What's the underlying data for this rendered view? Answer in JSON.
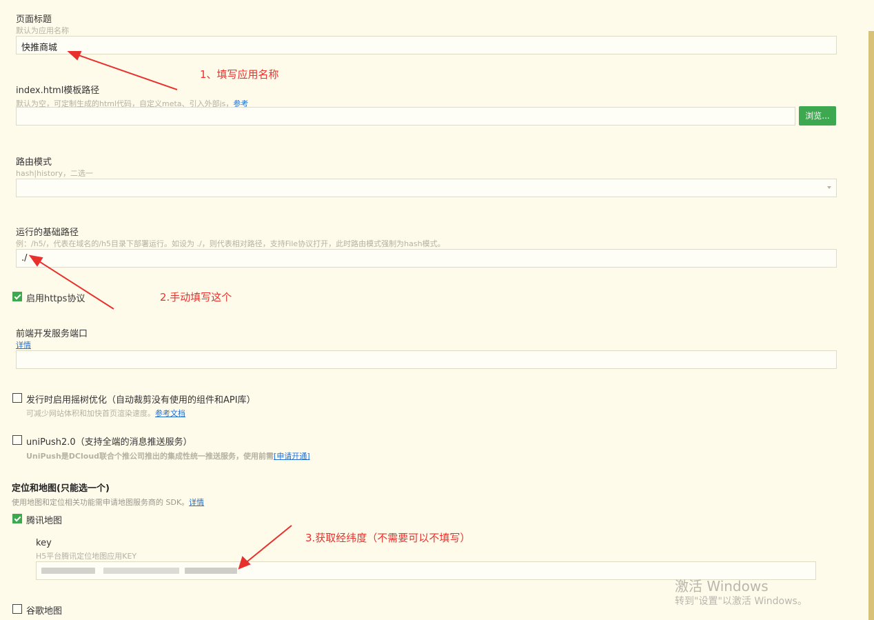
{
  "page_title": {
    "label": "页面标题",
    "hint": "默认为应用名称",
    "value": "快推商城"
  },
  "template_path": {
    "label": "index.html模板路径",
    "hint": "默认为空，可定制生成的html代码，自定义meta、引入外部js，",
    "hint_link": "参考",
    "value": "",
    "browse_label": "浏览..."
  },
  "router_mode": {
    "label": "路由模式",
    "hint": "hash|history，二选一",
    "value": ""
  },
  "base_path": {
    "label": "运行的基础路径",
    "hint": "例：/h5/，代表在域名的/h5目录下部署运行。如设为 ./，则代表相对路径，支持File协议打开，此时路由模式强制为hash模式。",
    "value": "./"
  },
  "https": {
    "label": "启用https协议",
    "checked": true
  },
  "dev_port": {
    "label": "前端开发服务端口",
    "link": "详情",
    "value": ""
  },
  "tree_shaking": {
    "label": "发行时启用摇树优化（自动裁剪没有使用的组件和API库）",
    "hint": "可减少网站体积和加快首页渲染速度。",
    "hint_link": "参考文档",
    "checked": false
  },
  "unipush": {
    "label": "uniPush2.0（支持全端的消息推送服务）",
    "hint": "UniPush是DCloud联合个推公司推出的集成性统一推送服务，使用前需",
    "hint_link": "[申请开通]",
    "checked": false
  },
  "location": {
    "title": "定位和地图(只能选一个)",
    "hint": "使用地图和定位相关功能需申请地图服务商的 SDK。",
    "hint_link": "详情"
  },
  "tencent_map": {
    "label": "腾讯地图",
    "checked": true,
    "key_label": "key",
    "key_hint": "H5平台腾讯定位地图应用KEY"
  },
  "google_map": {
    "label": "谷歌地图",
    "checked": false
  },
  "annotations": {
    "a1": "1、填写应用名称",
    "a2": "2.手动填写这个",
    "a3": "3.获取经纬度（不需要可以不填写）"
  },
  "watermark": {
    "line1": "激活 Windows",
    "line2": "转到\"设置\"以激活 Windows。"
  },
  "colors": {
    "background": "#fffbeb",
    "accent_green": "#3da84f",
    "annotation_red": "#e8312d",
    "link_blue": "#1e6fd0"
  }
}
